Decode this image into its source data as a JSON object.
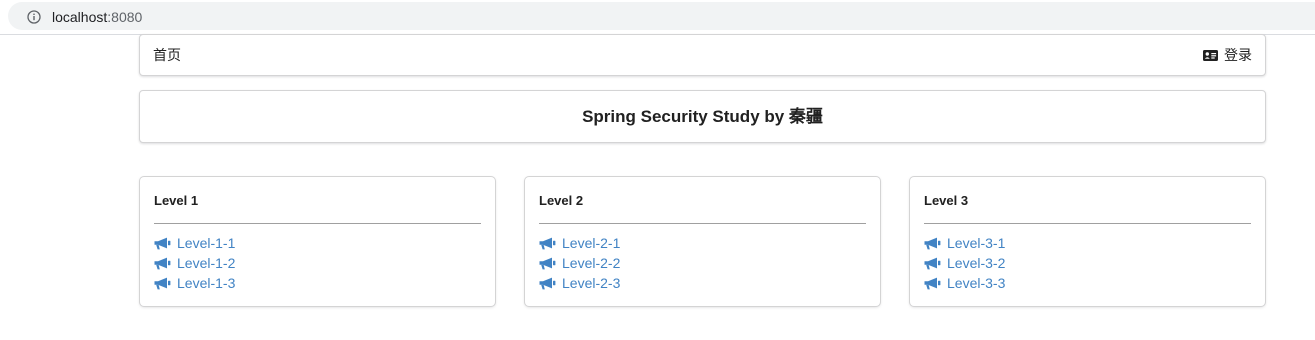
{
  "browser": {
    "url_host": "localhost",
    "url_port": ":8080"
  },
  "menu": {
    "home_label": "首页",
    "login_label": "登录"
  },
  "title": "Spring Security Study by 秦疆",
  "cards": [
    {
      "header": "Level 1",
      "links": [
        "Level-1-1",
        "Level-1-2",
        "Level-1-3"
      ]
    },
    {
      "header": "Level 2",
      "links": [
        "Level-2-1",
        "Level-2-2",
        "Level-2-3"
      ]
    },
    {
      "header": "Level 3",
      "links": [
        "Level-3-1",
        "Level-3-2",
        "Level-3-3"
      ]
    }
  ],
  "colors": {
    "link": "#4183c4",
    "text": "#212121",
    "border": "#d4d4d5"
  }
}
